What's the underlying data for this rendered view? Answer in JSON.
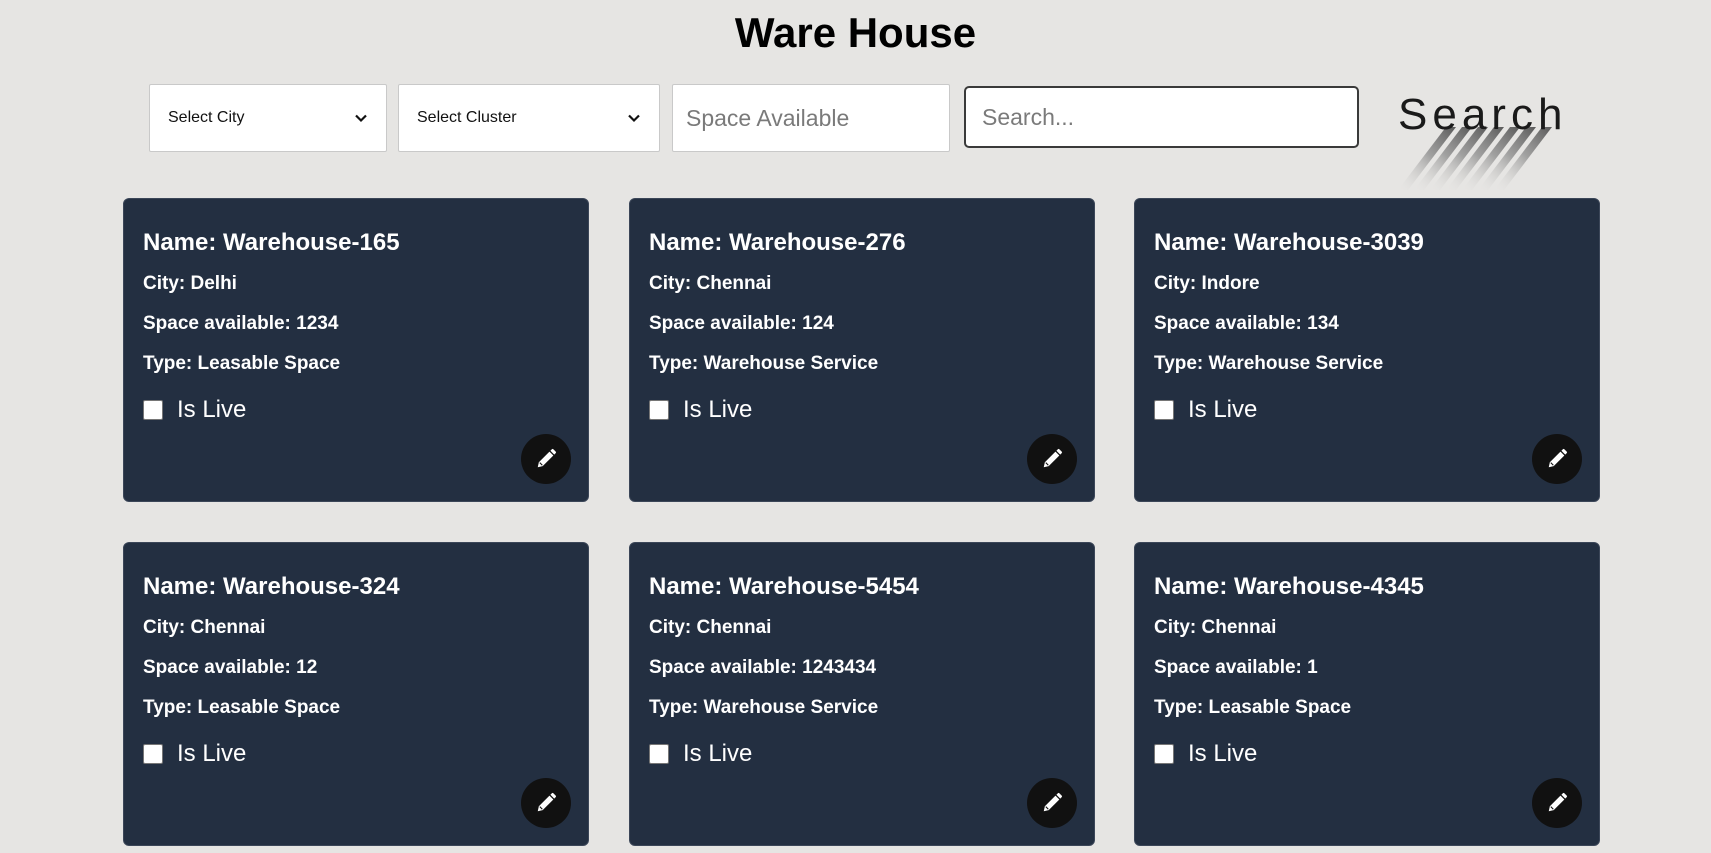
{
  "title": "Ware House",
  "filters": {
    "city_select": "Select City",
    "cluster_select": "Select Cluster",
    "space_placeholder": "Space Available",
    "search_placeholder": "Search...",
    "search_button": "Search"
  },
  "icons": {
    "dropdown": "chevron-down-icon",
    "edit": "pencil-icon"
  },
  "colors": {
    "background": "#e6e5e3",
    "card": "#232f41",
    "edit_button": "#111111"
  },
  "warehouses": [
    {
      "name": "Name: Warehouse-165",
      "city": "City: Delhi",
      "space": "Space available: 1234",
      "type": "Type: Leasable Space",
      "live_label": "Is Live",
      "is_live": false
    },
    {
      "name": "Name: Warehouse-276",
      "city": "City: Chennai",
      "space": "Space available: 124",
      "type": "Type: Warehouse Service",
      "live_label": "Is Live",
      "is_live": false
    },
    {
      "name": "Name: Warehouse-3039",
      "city": "City: Indore",
      "space": "Space available: 134",
      "type": "Type: Warehouse Service",
      "live_label": "Is Live",
      "is_live": false
    },
    {
      "name": "Name: Warehouse-324",
      "city": "City: Chennai",
      "space": "Space available: 12",
      "type": "Type: Leasable Space",
      "live_label": "Is Live",
      "is_live": false
    },
    {
      "name": "Name: Warehouse-5454",
      "city": "City: Chennai",
      "space": "Space available: 1243434",
      "type": "Type: Warehouse Service",
      "live_label": "Is Live",
      "is_live": false
    },
    {
      "name": "Name: Warehouse-4345",
      "city": "City: Chennai",
      "space": "Space available: 1",
      "type": "Type: Leasable Space",
      "live_label": "Is Live",
      "is_live": false
    }
  ]
}
